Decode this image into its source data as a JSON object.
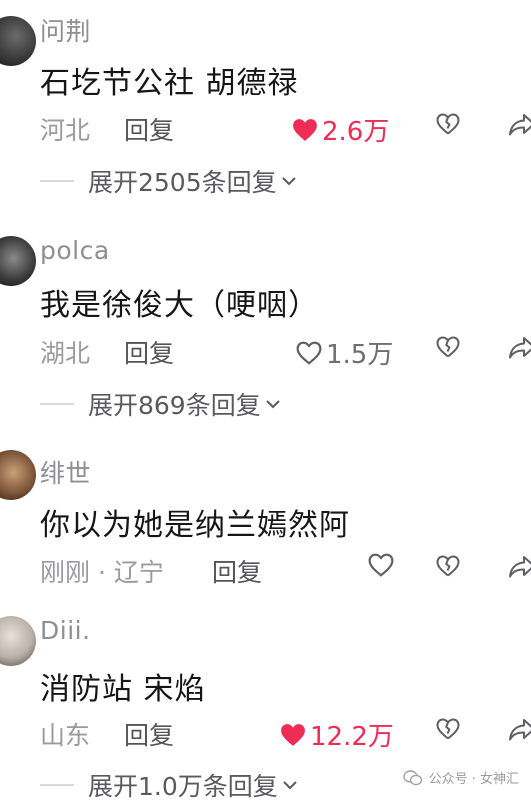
{
  "comments": [
    {
      "username": "问荆",
      "text": "石圪节公社 胡德禄",
      "location": "河北",
      "reply_label": "回复",
      "likes": "2.6万",
      "liked": true,
      "expand": "展开2505条回复"
    },
    {
      "username": "polca",
      "text": "我是徐俊大（哽咽）",
      "location": "湖北",
      "reply_label": "回复",
      "likes": "1.5万",
      "liked": false,
      "expand": "展开869条回复"
    },
    {
      "username": "绯世",
      "text": "你以为她是纳兰嫣然阿",
      "location": "刚刚 · 辽宁",
      "reply_label": "回复",
      "likes": "",
      "liked": false,
      "expand": ""
    },
    {
      "username": "Diii.",
      "text": "消防站  宋焰",
      "location": "山东",
      "reply_label": "回复",
      "likes": "12.2万",
      "liked": true,
      "expand": "展开1.0万条回复"
    }
  ],
  "watermark": {
    "text": "公众号 · 女神汇"
  },
  "colors": {
    "like_active": "#ee2c55",
    "text_primary": "#161616",
    "text_secondary": "#8e8e93"
  },
  "icons": {
    "like": "heart-icon",
    "dislike": "broken-heart-icon",
    "share": "share-arrow-icon",
    "expand": "chevron-down-icon",
    "watermark": "wechat-icon"
  }
}
